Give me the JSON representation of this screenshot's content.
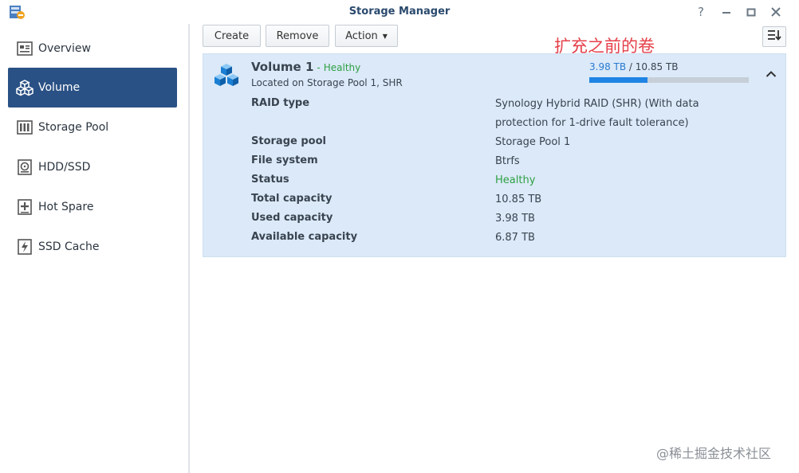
{
  "window": {
    "title": "Storage Manager",
    "controls": [
      "help-icon",
      "minimize-icon",
      "maximize-icon",
      "close-icon"
    ]
  },
  "sidebar": {
    "items": [
      {
        "label": "Overview",
        "icon": "overview-icon",
        "active": false
      },
      {
        "label": "Volume",
        "icon": "volume-icon",
        "active": true
      },
      {
        "label": "Storage Pool",
        "icon": "storage-pool-icon",
        "active": false
      },
      {
        "label": "HDD/SSD",
        "icon": "disk-icon",
        "active": false
      },
      {
        "label": "Hot Spare",
        "icon": "hot-spare-icon",
        "active": false
      },
      {
        "label": "SSD Cache",
        "icon": "ssd-cache-icon",
        "active": false
      }
    ]
  },
  "toolbar": {
    "create_label": "Create",
    "remove_label": "Remove",
    "action_label": "Action"
  },
  "annotation": "扩充之前的卷",
  "volume": {
    "name": "Volume 1",
    "separator": "-",
    "status": "Healthy",
    "location": "Located on Storage Pool 1, SHR",
    "used": "3.98 TB",
    "total": "10.85 TB",
    "cap_sep": " / ",
    "usage_fraction": 0.367,
    "properties": [
      {
        "label": "RAID type",
        "value": "Synology Hybrid RAID (SHR) (With data protection for 1-drive fault tolerance)"
      },
      {
        "label": "Storage pool",
        "value": "Storage Pool 1"
      },
      {
        "label": "File system",
        "value": "Btrfs"
      },
      {
        "label": "Status",
        "value": "Healthy"
      },
      {
        "label": "Total capacity",
        "value": "10.85 TB"
      },
      {
        "label": "Used capacity",
        "value": "3.98 TB"
      },
      {
        "label": "Available capacity",
        "value": "6.87 TB"
      }
    ]
  },
  "colors": {
    "accent": "#2a5185",
    "healthy": "#2ea043",
    "bar": "#1f84e4",
    "panel": "#dbe9f8"
  },
  "watermark": "@稀土掘金技术社区"
}
